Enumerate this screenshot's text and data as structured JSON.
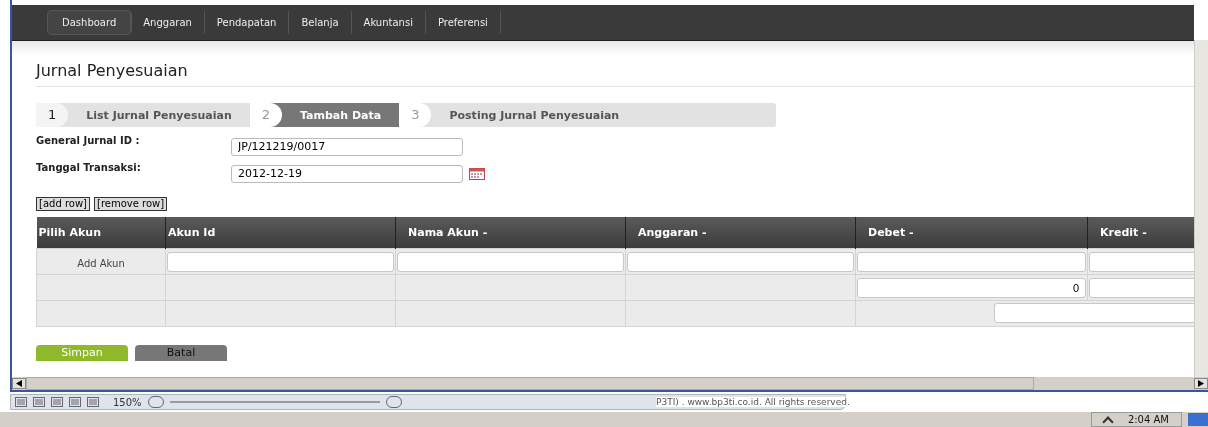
{
  "nav": [
    {
      "label": "Dashboard",
      "selected": true
    },
    {
      "label": "Anggaran",
      "selected": false
    },
    {
      "label": "Pendapatan",
      "selected": false
    },
    {
      "label": "Belanja",
      "selected": false
    },
    {
      "label": "Akuntansi",
      "selected": false
    },
    {
      "label": "Preferensi",
      "selected": false
    }
  ],
  "page_title": "Jurnal Penyesuaian",
  "steps": [
    {
      "number": "1",
      "label": "List Jurnal Penyesuaian",
      "selected": false
    },
    {
      "number": "2",
      "label": "Tambah Data",
      "selected": true
    },
    {
      "number": "3",
      "label": "Posting Jurnal Penyesuaian",
      "selected": false
    }
  ],
  "form": [
    {
      "label": "General Jurnal ID :",
      "value": "JP/121219/0017",
      "kind": "text"
    },
    {
      "label": "Tanggal Transaksi:",
      "value": "2012-12-19",
      "kind": "date"
    }
  ],
  "row_actions": [
    "[add row]",
    "[remove row]"
  ],
  "table": {
    "columns": [
      "Pilih Akun",
      "Akun Id",
      "Nama Akun -",
      "Anggaran -",
      "Debet -",
      "Kredit -"
    ],
    "rows": [
      {
        "cells": [
          {
            "kind": "link",
            "text": "Add Akun"
          },
          {
            "kind": "input"
          },
          {
            "kind": "input"
          },
          {
            "kind": "input"
          },
          {
            "kind": "input"
          },
          {
            "kind": "input"
          }
        ]
      },
      {
        "cells": [
          {
            "kind": "blank"
          },
          {
            "kind": "blank"
          },
          {
            "kind": "blank"
          },
          {
            "kind": "blank"
          },
          {
            "kind": "input",
            "value": "0"
          },
          {
            "kind": "input"
          }
        ]
      },
      {
        "cells": [
          {
            "kind": "blank"
          },
          {
            "kind": "blank"
          },
          {
            "kind": "blank"
          },
          {
            "kind": "blank"
          },
          {
            "kind": "total_input"
          }
        ]
      }
    ]
  },
  "buttons": [
    {
      "label": "Simpan",
      "kind": "primary"
    },
    {
      "label": "Batal",
      "kind": "secondary"
    }
  ],
  "status_bar": {
    "zoom": "150%",
    "footer": "P3TI) . www.bp3ti.co.id. All rights reserved."
  },
  "taskbar": {
    "time": "2:04 AM"
  }
}
